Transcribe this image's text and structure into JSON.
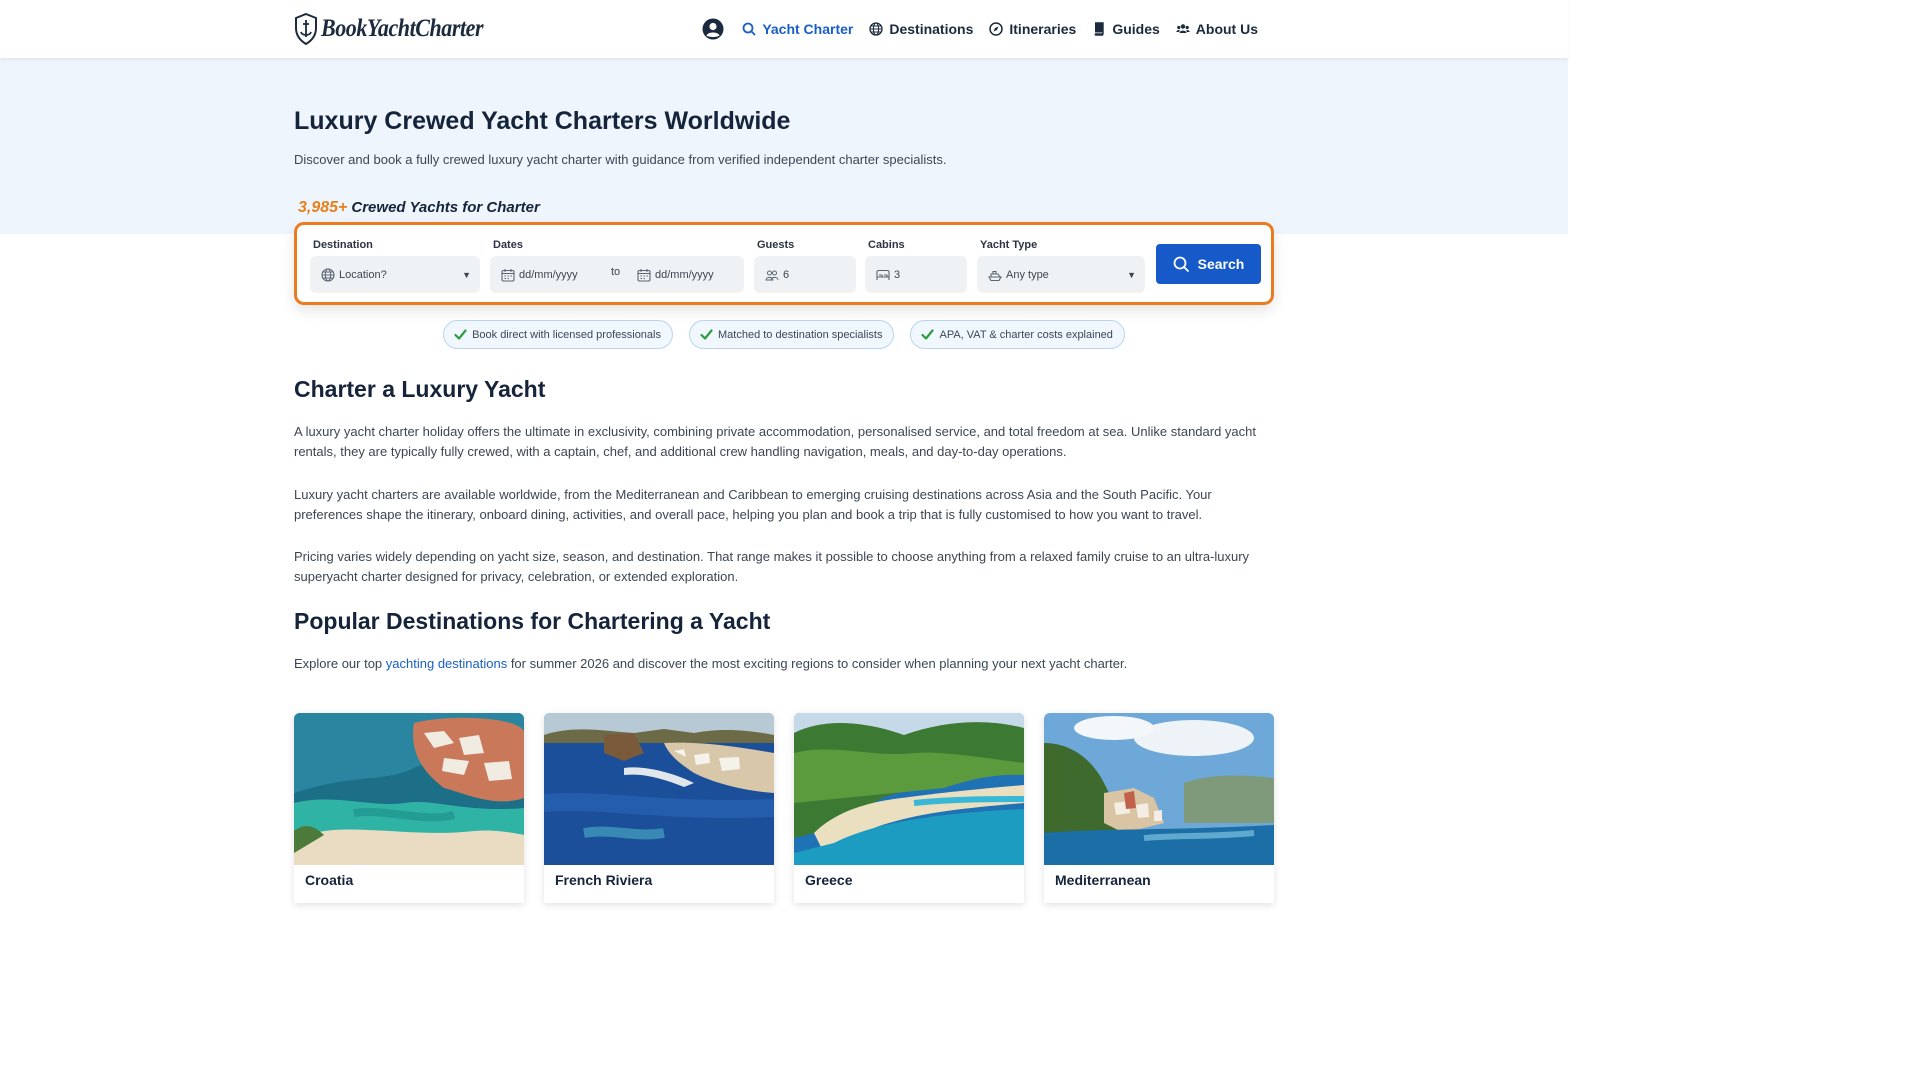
{
  "header": {
    "logo_text": "BookYachtCharter",
    "nav": [
      {
        "label": "Yacht Charter",
        "icon": "search-icon",
        "active": true
      },
      {
        "label": "Destinations",
        "icon": "globe-icon"
      },
      {
        "label": "Itineraries",
        "icon": "compass-icon"
      },
      {
        "label": "Guides",
        "icon": "book-icon"
      },
      {
        "label": "About Us",
        "icon": "users-icon"
      }
    ]
  },
  "hero": {
    "title": "Luxury Crewed Yacht Charters Worldwide",
    "subtitle": "Discover and book a fully crewed luxury yacht charter with guidance from verified independent charter specialists.",
    "count": "3,985+",
    "count_label": "Crewed Yachts for Charter"
  },
  "search": {
    "destination_label": "Destination",
    "destination_value": "Location?",
    "dates_label": "Dates",
    "date_from": "dd/mm/yyyy",
    "date_to_word": "to",
    "date_to": "dd/mm/yyyy",
    "guests_label": "Guests",
    "guests_value": "6",
    "cabins_label": "Cabins",
    "cabins_value": "3",
    "type_label": "Yacht Type",
    "type_value": "Any type",
    "button_label": "Search"
  },
  "pills": [
    "Book direct with licensed professionals",
    "Matched to destination specialists",
    "APA, VAT & charter costs explained"
  ],
  "section1": {
    "title": "Charter a Luxury Yacht",
    "p1": "A luxury yacht charter holiday offers the ultimate in exclusivity, combining private accommodation, personalised service, and total freedom at sea. Unlike standard yacht rentals, they are typically fully crewed, with a captain, chef, and additional crew handling navigation, meals, and day-to-day operations.",
    "p2": "Luxury yacht charters are available worldwide, from the Mediterranean and Caribbean to emerging cruising destinations across Asia and the South Pacific. Your preferences shape the itinerary, onboard dining, activities, and overall pace, helping you plan and book a trip that is fully customised to how you want to travel.",
    "p3": "Pricing varies widely depending on yacht size, season, and destination. That range makes it possible to choose anything from a relaxed family cruise to an ultra-luxury superyacht charter designed for privacy, celebration, or extended exploration."
  },
  "section2": {
    "title": "Popular Destinations for Chartering a Yacht",
    "intro_before": "Explore our top ",
    "intro_link": "yachting destinations",
    "intro_after": " for summer 2026 and discover the most exciting regions to consider when planning your next yacht charter."
  },
  "cards": [
    {
      "title": "Croatia"
    },
    {
      "title": "French Riviera"
    },
    {
      "title": "Greece"
    },
    {
      "title": "Mediterranean"
    }
  ],
  "colors": {
    "accent": "#1659c9",
    "highlight": "#e8801a",
    "hero_bg": "#eef5fd"
  }
}
